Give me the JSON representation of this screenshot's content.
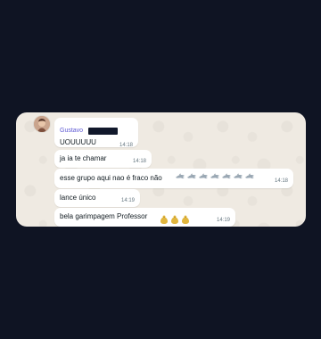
{
  "chat": {
    "sender": {
      "name": "Gustavo",
      "avatar_icon": "person-avatar"
    },
    "messages": [
      {
        "text": "UOUUUUU",
        "time": "14:18"
      },
      {
        "text": "ja ia te chamar",
        "time": "14:18"
      },
      {
        "text": "esse grupo aqui nao é fraco não",
        "time": "14:18",
        "emoji_icon": "shark-icon",
        "emoji_count": 7
      },
      {
        "text": "lance único",
        "time": "14:19"
      },
      {
        "text": "bela garimpagem Professor",
        "time": "14:19",
        "emoji_icon": "gold-bag-icon",
        "emoji_count": 3
      }
    ]
  },
  "colors": {
    "page_background": "#0f1423",
    "chat_background": "#efeae2",
    "bubble_background": "#ffffff",
    "sender_name": "#5e5ad4",
    "timestamp": "#667781",
    "redaction": "#11182b"
  }
}
